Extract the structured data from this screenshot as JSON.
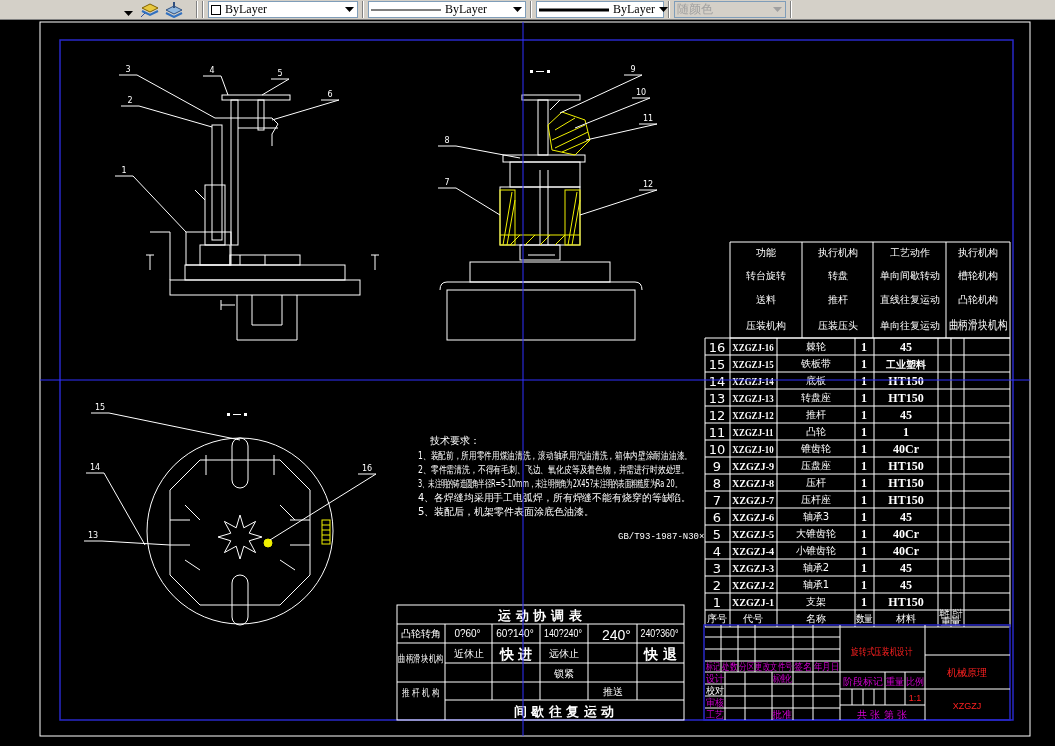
{
  "toolbar": {
    "combos": [
      {
        "kind": "color",
        "value": "ByLayer",
        "disabled": false
      },
      {
        "kind": "linetype",
        "value": "ByLayer",
        "disabled": false
      },
      {
        "kind": "lineweight",
        "value": "ByLayer",
        "disabled": false
      },
      {
        "kind": "plotstyle",
        "value": "随颜色",
        "disabled": true
      }
    ]
  },
  "front_view": {
    "balloons": [
      "3",
      "4",
      "5",
      "2",
      "6",
      "1"
    ]
  },
  "side_view": {
    "balloons": [
      "9",
      "10",
      "8",
      "11",
      "7",
      "12"
    ]
  },
  "top_view": {
    "balloons": [
      "15",
      "14",
      "13",
      "16"
    ]
  },
  "technical_requirements": {
    "title": "技术要求：",
    "items": [
      "1、装配前，所用零件用煤油清洗，滚动轴承用汽油清洗，箱体内壁涂耐油油漆。",
      "2、零件需清洗，不得有毛刺、飞边、氧化皮等及着色物，并需进行时效处理。",
      "3、未注明的铸造圆角半径R=5-10mm，未注明倒角为2X45?未注明的表面粗糙度为Ra 20。",
      "4、各焊缝均采用手工电弧焊，所有焊缝不能有烧穿的等缺陷。",
      "5、装配后，机架零件表面涂底色油漆。"
    ]
  },
  "standard_note": "GB/T93-1987-N30×",
  "function_table": {
    "rows": [
      [
        "功能",
        "执行机构",
        "工艺动作",
        "执行机构"
      ],
      [
        "转台旋转",
        "转盘",
        "单向间歇转动",
        "槽轮机构"
      ],
      [
        "送料",
        "推杆",
        "直线往复运动",
        "凸轮机构"
      ],
      [
        "压装机构",
        "压装压头",
        "单向往复运动",
        "曲柄滑块机构"
      ]
    ]
  },
  "parts_list": {
    "rows": [
      {
        "no": "16",
        "code": "XZGZJ-16",
        "name": "棘轮",
        "qty": "1",
        "material": "45"
      },
      {
        "no": "15",
        "code": "XZGZJ-15",
        "name": "铁板带",
        "qty": "1",
        "material": "工业塑料"
      },
      {
        "no": "14",
        "code": "XZGZJ-14",
        "name": "底板",
        "qty": "1",
        "material": "HT150"
      },
      {
        "no": "13",
        "code": "XZGZJ-13",
        "name": "转盘座",
        "qty": "1",
        "material": "HT150"
      },
      {
        "no": "12",
        "code": "XZGZJ-12",
        "name": "推杆",
        "qty": "1",
        "material": "45"
      },
      {
        "no": "11",
        "code": "XZGZJ-11",
        "name": "凸轮",
        "qty": "1",
        "material": "1"
      },
      {
        "no": "10",
        "code": "XZGZJ-10",
        "name": "锥齿轮",
        "qty": "1",
        "material": "40Cr"
      },
      {
        "no": "9",
        "code": "XZGZJ-9",
        "name": "压盘座",
        "qty": "1",
        "material": "HT150"
      },
      {
        "no": "8",
        "code": "XZGZJ-8",
        "name": "压杆",
        "qty": "1",
        "material": "HT150"
      },
      {
        "no": "7",
        "code": "XZGZJ-7",
        "name": "压杆座",
        "qty": "1",
        "material": "HT150"
      },
      {
        "no": "6",
        "code": "XZGZJ-6",
        "name": "轴承3",
        "qty": "1",
        "material": "45"
      },
      {
        "no": "5",
        "code": "XZGZJ-5",
        "name": "大锥齿轮",
        "qty": "1",
        "material": "40Cr"
      },
      {
        "no": "4",
        "code": "XZGZJ-4",
        "name": "小锥齿轮",
        "qty": "1",
        "material": "40Cr"
      },
      {
        "no": "3",
        "code": "XZGZJ-3",
        "name": "轴承2",
        "qty": "1",
        "material": "45"
      },
      {
        "no": "2",
        "code": "XZGZJ-2",
        "name": "轴承1",
        "qty": "1",
        "material": "45"
      },
      {
        "no": "1",
        "code": "XZGZJ-1",
        "name": "支架",
        "qty": "1",
        "material": "HT150"
      }
    ],
    "header": [
      "序号",
      "代号",
      "名称",
      "数量",
      "材料"
    ],
    "weight_header": [
      "单件",
      "总计",
      "重量"
    ]
  },
  "motion_table": {
    "title": "运 动 协 调 表",
    "angle_label": "凸轮转角",
    "angles": [
      "0?60°",
      "60?140°",
      "140?240°",
      "240°",
      "240?360°"
    ],
    "groups": [
      {
        "label": "曲柄滑块机构",
        "rows": [
          [
            "近休止",
            "快 进",
            "远休止",
            null,
            "快 退"
          ],
          [
            null,
            null,
            "锁紧",
            null,
            null
          ]
        ]
      },
      {
        "label": "推 杆 机 构",
        "rows": [
          [
            null,
            null,
            null,
            "推送",
            null
          ]
        ],
        "summary": "间 歇 往 复 运 动"
      }
    ]
  },
  "title_block": {
    "revision_headers": [
      "标记",
      "处数",
      "分区",
      "更改文件号",
      "签名",
      "年月日"
    ],
    "signoff_labels": [
      {
        "text": "设计",
        "highlighted": false
      },
      {
        "text": "校对",
        "highlighted": true
      },
      {
        "text": "审核",
        "highlighted": false
      },
      {
        "text": "工艺",
        "highlighted": false
      }
    ],
    "standardization": "标准化",
    "approval": "批准",
    "stage_headers": [
      "阶段标记",
      "重量",
      "比例"
    ],
    "scale": "1:1",
    "sheet": "共 张 第 张",
    "drawing_title": "旋转式压装机设计",
    "course": "机械原理",
    "drawing_code": "XZGZJ"
  }
}
